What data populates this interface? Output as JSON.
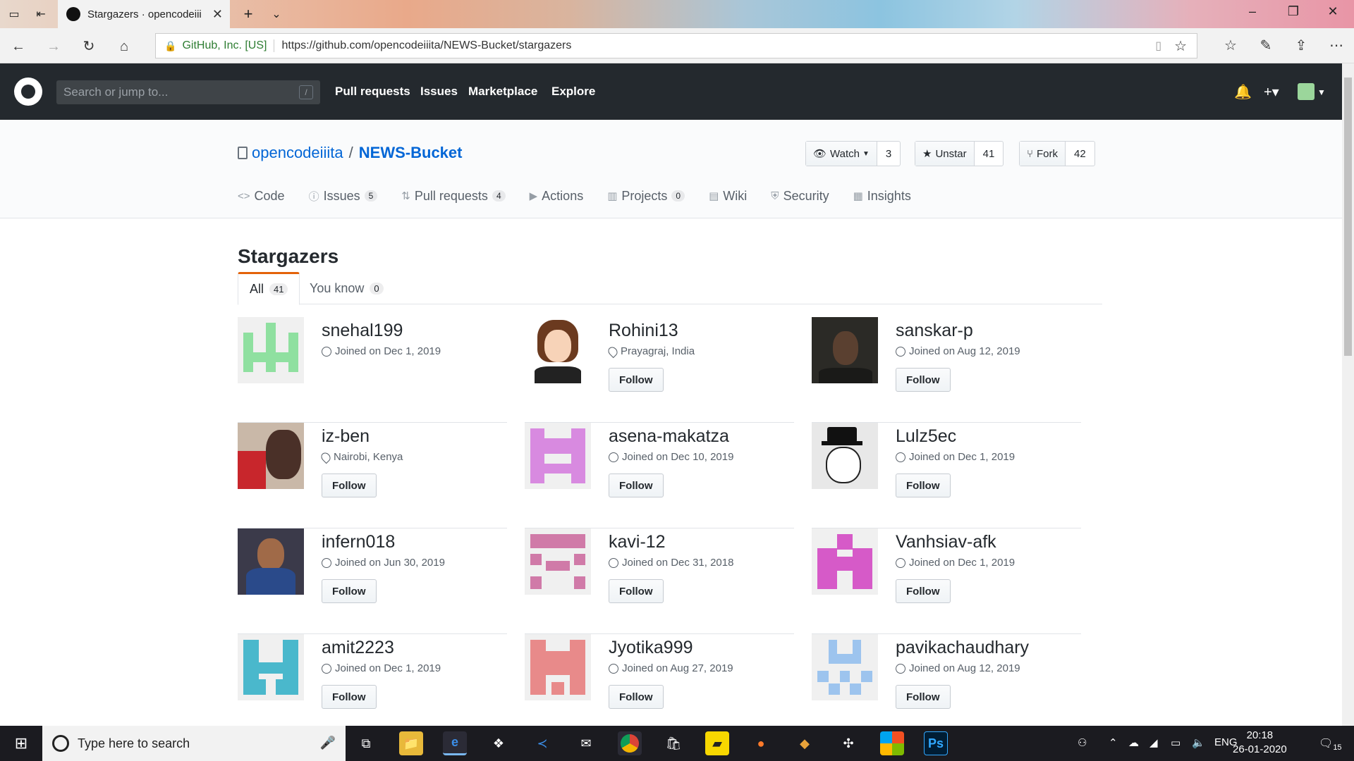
{
  "browser": {
    "tab_title": "Stargazers · opencodeiii",
    "cert_label": "GitHub, Inc. [US]",
    "url": "https://github.com/opencodeiiita/NEWS-Bucket/stargazers"
  },
  "gh_header": {
    "search_placeholder": "Search or jump to...",
    "search_shortcut": "/",
    "nav": [
      "Pull requests",
      "Issues",
      "Marketplace",
      "Explore"
    ]
  },
  "repo": {
    "owner": "opencodeiiita",
    "separator": "/",
    "name": "NEWS-Bucket",
    "watch_label": "Watch",
    "watch_count": "3",
    "star_label": "Unstar",
    "star_count": "41",
    "fork_label": "Fork",
    "fork_count": "42",
    "nav": [
      {
        "label": "Code",
        "count": null
      },
      {
        "label": "Issues",
        "count": "5"
      },
      {
        "label": "Pull requests",
        "count": "4"
      },
      {
        "label": "Actions",
        "count": null
      },
      {
        "label": "Projects",
        "count": "0"
      },
      {
        "label": "Wiki",
        "count": null
      },
      {
        "label": "Security",
        "count": null
      },
      {
        "label": "Insights",
        "count": null
      }
    ]
  },
  "stargazers": {
    "title": "Stargazers",
    "tabs": [
      {
        "label": "All",
        "count": "41"
      },
      {
        "label": "You know",
        "count": "0"
      }
    ],
    "follow_label": "Follow",
    "users": [
      {
        "name": "snehal199",
        "meta": "Joined on Dec 1, 2019",
        "meta_type": "clock",
        "follow": false
      },
      {
        "name": "Rohini13",
        "meta": "Prayagraj, India",
        "meta_type": "location",
        "follow": true
      },
      {
        "name": "sanskar-p",
        "meta": "Joined on Aug 12, 2019",
        "meta_type": "clock",
        "follow": true
      },
      {
        "name": "iz-ben",
        "meta": "Nairobi, Kenya",
        "meta_type": "location",
        "follow": true
      },
      {
        "name": "asena-makatza",
        "meta": "Joined on Dec 10, 2019",
        "meta_type": "clock",
        "follow": true
      },
      {
        "name": "Lulz5ec",
        "meta": "Joined on Dec 1, 2019",
        "meta_type": "clock",
        "follow": true
      },
      {
        "name": "infern018",
        "meta": "Joined on Jun 30, 2019",
        "meta_type": "clock",
        "follow": true
      },
      {
        "name": "kavi-12",
        "meta": "Joined on Dec 31, 2018",
        "meta_type": "clock",
        "follow": true
      },
      {
        "name": "Vanhsiav-afk",
        "meta": "Joined on Dec 1, 2019",
        "meta_type": "clock",
        "follow": true
      },
      {
        "name": "amit2223",
        "meta": "Joined on Dec 1, 2019",
        "meta_type": "clock",
        "follow": true
      },
      {
        "name": "Jyotika999",
        "meta": "Joined on Aug 27, 2019",
        "meta_type": "clock",
        "follow": true
      },
      {
        "name": "pavikachaudhary",
        "meta": "Joined on Aug 12, 2019",
        "meta_type": "clock",
        "follow": true
      }
    ]
  },
  "taskbar": {
    "search_placeholder": "Type here to search",
    "lang": "ENG",
    "time": "20:18",
    "date": "26-01-2020",
    "notifications": "15"
  },
  "colors": {
    "github_header": "#24292e",
    "link_blue": "#0366d6",
    "tab_accent": "#e36209"
  }
}
